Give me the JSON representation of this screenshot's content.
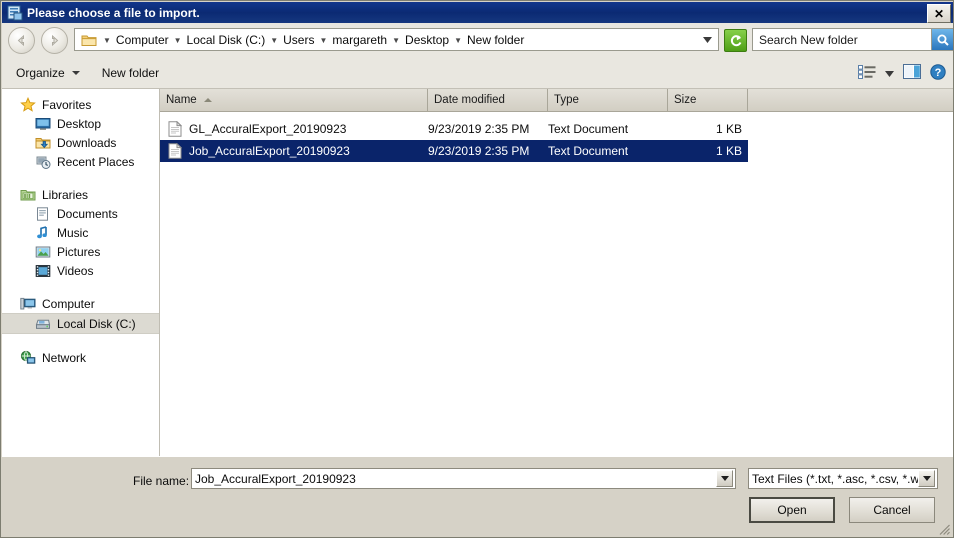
{
  "window": {
    "title": "Please choose a file to import.",
    "title_icon": "file-import-icon",
    "close_label": "✕",
    "accent_title_color": "#0b2a73",
    "selection_color": "#0a246a"
  },
  "navigation": {
    "back_icon": "back-arrow-icon",
    "forward_icon": "forward-arrow-icon",
    "breadcrumb": [
      "Computer",
      "Local Disk (C:)",
      "Users",
      "margareth",
      "Desktop",
      "New folder"
    ],
    "address_dropdown_icon": "chevron-down-icon",
    "refresh_icon": "refresh-icon"
  },
  "search": {
    "placeholder": "Search New folder",
    "icon": "search-icon"
  },
  "toolbar": {
    "organize_label": "Organize",
    "new_folder_label": "New folder",
    "view_icon": "list-view-icon",
    "view_dropdown_icon": "chevron-down-icon",
    "preview_pane_icon": "preview-pane-icon",
    "help_icon": "help-icon"
  },
  "sidebar": {
    "groups": [
      {
        "header": {
          "label": "Favorites",
          "icon": "star-icon"
        },
        "items": [
          {
            "label": "Desktop",
            "icon": "desktop-icon",
            "selected": false
          },
          {
            "label": "Downloads",
            "icon": "downloads-folder-icon",
            "selected": false
          },
          {
            "label": "Recent Places",
            "icon": "recent-places-icon",
            "selected": false
          }
        ]
      },
      {
        "header": {
          "label": "Libraries",
          "icon": "libraries-icon"
        },
        "items": [
          {
            "label": "Documents",
            "icon": "documents-icon",
            "selected": false
          },
          {
            "label": "Music",
            "icon": "music-icon",
            "selected": false
          },
          {
            "label": "Pictures",
            "icon": "pictures-icon",
            "selected": false
          },
          {
            "label": "Videos",
            "icon": "videos-icon",
            "selected": false
          }
        ]
      },
      {
        "header": {
          "label": "Computer",
          "icon": "computer-icon"
        },
        "items": [
          {
            "label": "Local Disk (C:)",
            "icon": "hard-drive-icon",
            "selected": true
          }
        ]
      },
      {
        "header": {
          "label": "Network",
          "icon": "network-icon"
        },
        "items": []
      }
    ]
  },
  "file_list": {
    "columns": [
      {
        "label": "Name",
        "sorted": "asc"
      },
      {
        "label": "Date modified",
        "sorted": ""
      },
      {
        "label": "Type",
        "sorted": ""
      },
      {
        "label": "Size",
        "sorted": ""
      }
    ],
    "rows": [
      {
        "name": "GL_AccuralExport_20190923",
        "date_modified": "9/23/2019 2:35 PM",
        "type": "Text Document",
        "size": "1 KB",
        "icon": "text-document-icon",
        "selected": false
      },
      {
        "name": "Job_AccuralExport_20190923",
        "date_modified": "9/23/2019 2:35 PM",
        "type": "Text Document",
        "size": "1 KB",
        "icon": "text-document-icon",
        "selected": true
      }
    ]
  },
  "footer": {
    "filename_label": "File name:",
    "filename_value": "Job_AccuralExport_20190923",
    "filename_dropdown_icon": "chevron-down-icon",
    "filter_value": "Text Files (*.txt, *.asc, *.csv, *.wvf",
    "filter_dropdown_icon": "chevron-down-icon",
    "open_label": "Open",
    "cancel_label": "Cancel",
    "resize_grip_icon": "resize-grip-icon"
  }
}
